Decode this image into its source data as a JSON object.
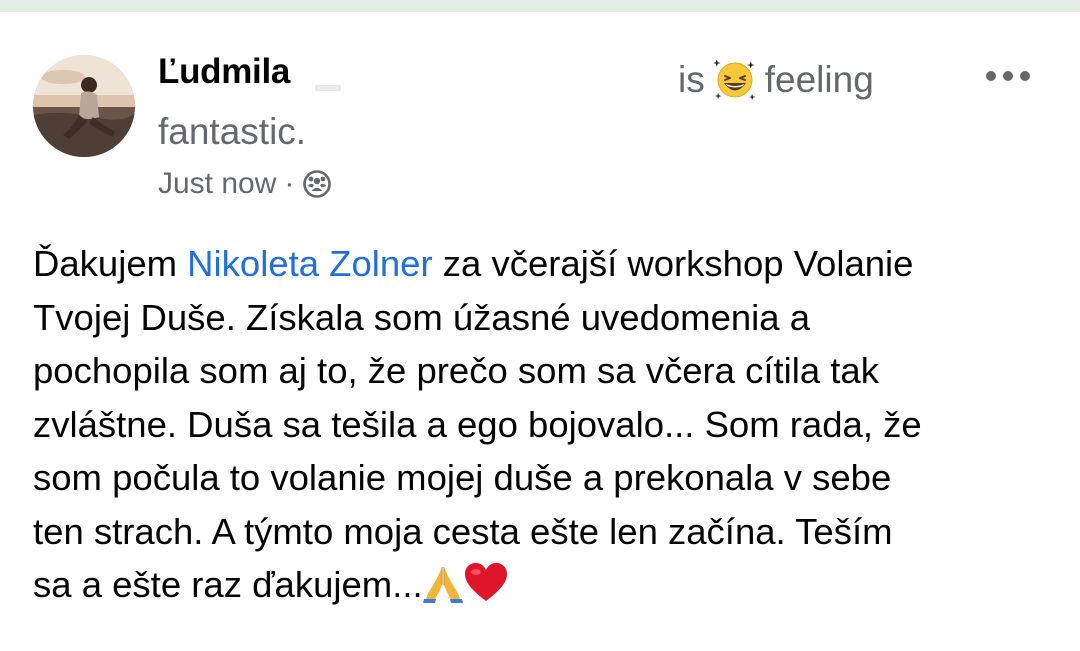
{
  "post": {
    "author": {
      "name": "Ľudmila",
      "avatar": "profile-photo"
    },
    "activity": {
      "prefix": "is",
      "emoji": "grinning-squinting-face-emoji",
      "word": "feeling",
      "state": "fantastic."
    },
    "meta": {
      "time": "Just now",
      "separator": "·",
      "audience_icon": "friends-audience-icon"
    },
    "menu_icon": "more-options-icon",
    "body": {
      "line1_before": "Ďakujem ",
      "mention": "Nikoleta Zolner",
      "line1_after": " za včerajší workshop Volanie",
      "line2": "Tvojej Duše. Získala som úžasné uvedomenia a",
      "line3": "pochopila som aj to, že prečo som sa včera cítila tak",
      "line4": "zvláštne. Duša sa tešila a ego bojovalo... Som rada, že",
      "line5": "som počula to volanie mojej duše a prekonala v sebe",
      "line6": "ten strach. A týmto moja cesta ešte len začína. Teším",
      "line7": "sa a ešte raz ďakujem...",
      "trailing_emojis": [
        "folded-hands-emoji",
        "red-heart-emoji"
      ]
    }
  },
  "colors": {
    "name_text": "#050505",
    "secondary_text": "#65676b",
    "mention_link": "#216fdb",
    "top_band": "#e4ede4",
    "heart": "#e0142a"
  }
}
